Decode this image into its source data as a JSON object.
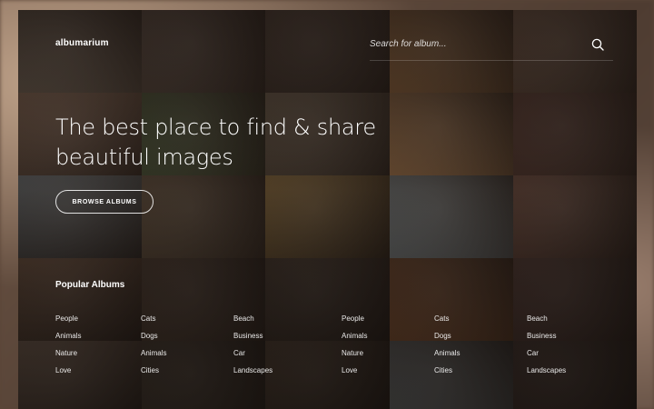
{
  "app": {
    "name": "albumarium"
  },
  "search": {
    "placeholder": "Search for album..."
  },
  "hero": {
    "line1": "The best place to find & share",
    "line2": "beautiful images",
    "button_label": "BROWSE ALBUMS"
  },
  "popular": {
    "title": "Popular Albums",
    "columns": [
      [
        "People",
        "Animals",
        "Nature",
        "Love"
      ],
      [
        "Cats",
        "Dogs",
        "Animals",
        "Cities"
      ],
      [
        "Beach",
        "Business",
        "Car",
        "Landscapes"
      ],
      [
        "People",
        "Animals",
        "Nature",
        "Love"
      ],
      [
        "Cats",
        "Dogs",
        "Animals",
        "Cities"
      ],
      [
        "Beach",
        "Business",
        "Car",
        "Landscapes"
      ]
    ]
  },
  "mosaic_colors": [
    "#7a6a5a",
    "#5b4a3f",
    "#4a3a30",
    "#9a6a3e",
    "#6c5140",
    "#8a6a55",
    "#4f5a3a",
    "#6b5a48",
    "#b07d4e",
    "#5a3a30",
    "#6a6e70",
    "#6a5540",
    "#8a6a3a",
    "#8c9496",
    "#6e4a3c",
    "#7a5a44",
    "#5a4536",
    "#4a3a2e",
    "#a8663a",
    "#5a3e36",
    "#8a6f5c",
    "#5a4a3c",
    "#5a4636",
    "#9aa0a2",
    "#4e3a32"
  ]
}
